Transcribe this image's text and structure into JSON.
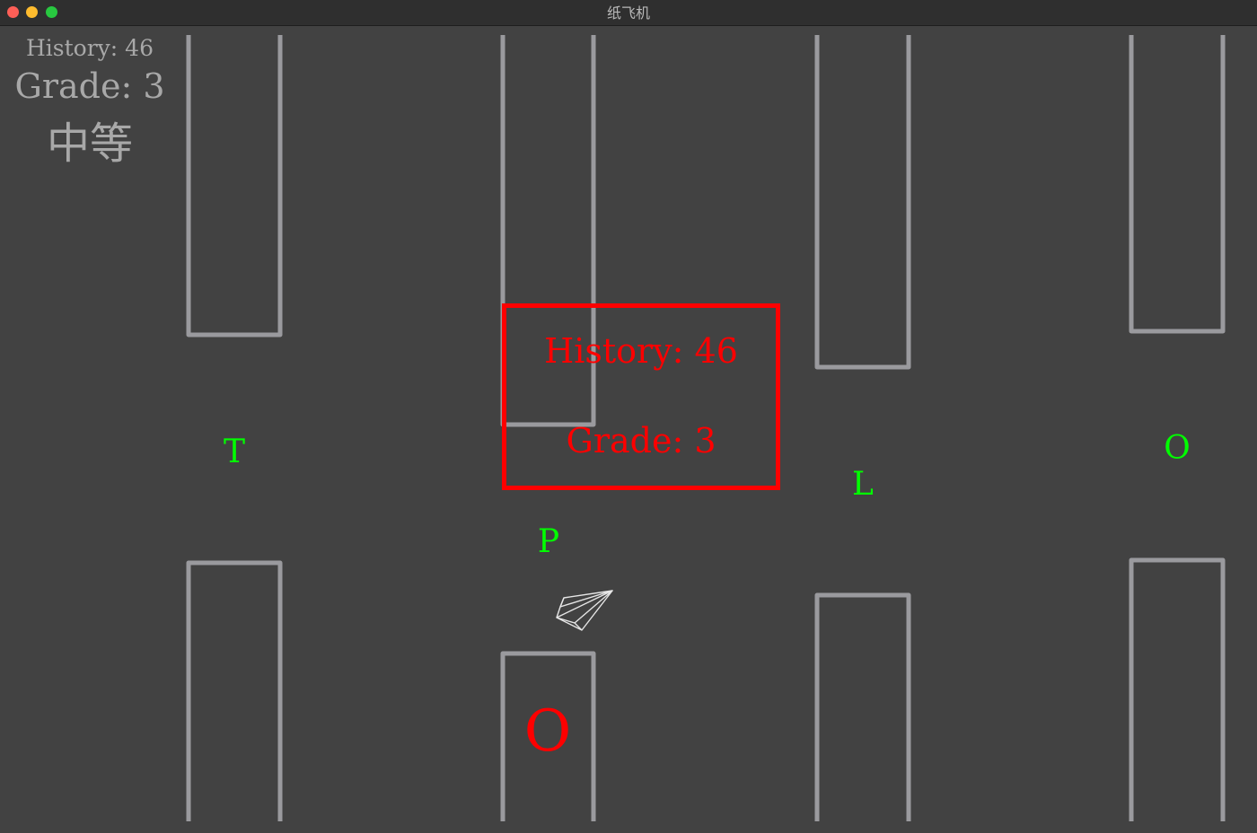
{
  "window": {
    "title": "纸飞机"
  },
  "hud": {
    "history": "History:  46",
    "grade": "Grade:  3",
    "level": "中等"
  },
  "letters": [
    "T",
    "P",
    "L",
    "O"
  ],
  "obstacle_letter": "O",
  "score_panel": {
    "history": "History:  46",
    "grade": "Grade:  3"
  },
  "colors": {
    "background": "#424242",
    "pipe": "#9a9a9e",
    "letter": "#00ff00",
    "score": "#ff0000",
    "hud_text": "#a8a8a8"
  },
  "icons": {
    "player": "paper-plane-icon"
  }
}
